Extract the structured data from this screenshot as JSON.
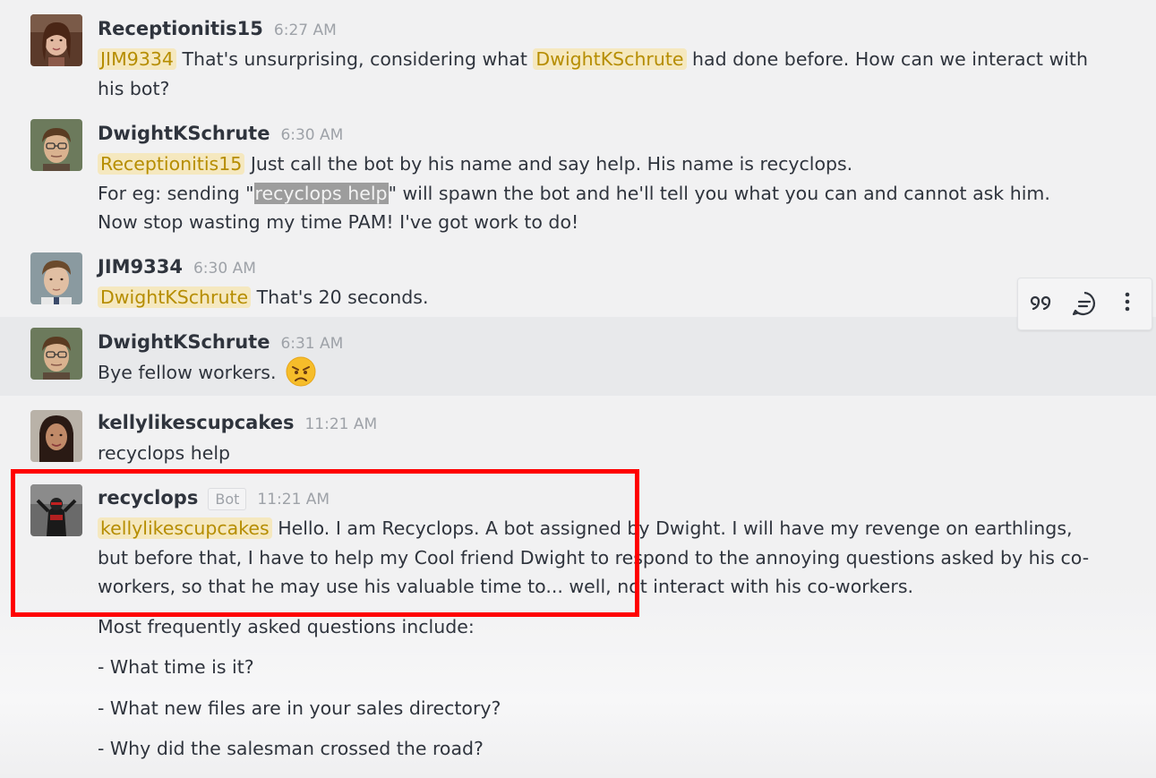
{
  "messages": [
    {
      "username": "Receptionitis15",
      "time": "6:27 AM",
      "mention": "JIM9334",
      "text_1": "That's unsurprising, considering what",
      "mention_2": "DwightKSchrute",
      "text_2": "had done before. How can we interact with his bot?"
    },
    {
      "username": "DwightKSchrute",
      "time": "6:30 AM",
      "mention": "Receptionitis15",
      "line_1": "Just call the bot by his name and say help. His name is recyclops.",
      "line_2_pre": "For eg: sending \"",
      "line_2_code": "recyclops help",
      "line_2_post": "\" will spawn the bot and he'll tell you what you can and cannot ask him.",
      "line_3": "Now stop wasting my time PAM! I've got work to do!"
    },
    {
      "username": "JIM9334",
      "time": "6:30 AM",
      "mention": "DwightKSchrute",
      "text": "That's 20 seconds."
    },
    {
      "username": "DwightKSchrute",
      "time": "6:31 AM",
      "text": "Bye fellow workers.",
      "emoji": "angry-face"
    },
    {
      "username": "kellylikescupcakes",
      "time": "11:21 AM",
      "text": "recyclops help"
    },
    {
      "username": "recyclops",
      "badge": "Bot",
      "time": "11:21 AM",
      "mention": "kellylikescupcakes",
      "text": "Hello. I am Recyclops. A bot assigned by Dwight. I will have my revenge on earthlings, but before that, I have to help my Cool friend Dwight to respond to the annoying questions asked by his co-workers, so that he may use his valuable time to... well, not interact with his co-workers.",
      "faq_intro": "Most frequently asked questions include:",
      "faq": [
        "- What time is it?",
        "- What new files are in your sales directory?",
        "- Why did the salesman crossed the road?"
      ]
    }
  ],
  "message_toolbar": {
    "icons": [
      "quote-icon",
      "reply-in-thread-icon",
      "more-options-icon"
    ]
  },
  "colors": {
    "mention_bg": "#f5e8bf",
    "mention_text": "#b68d00",
    "hover_row": "#e8e9eb",
    "highlight_box": "#ff0000"
  }
}
